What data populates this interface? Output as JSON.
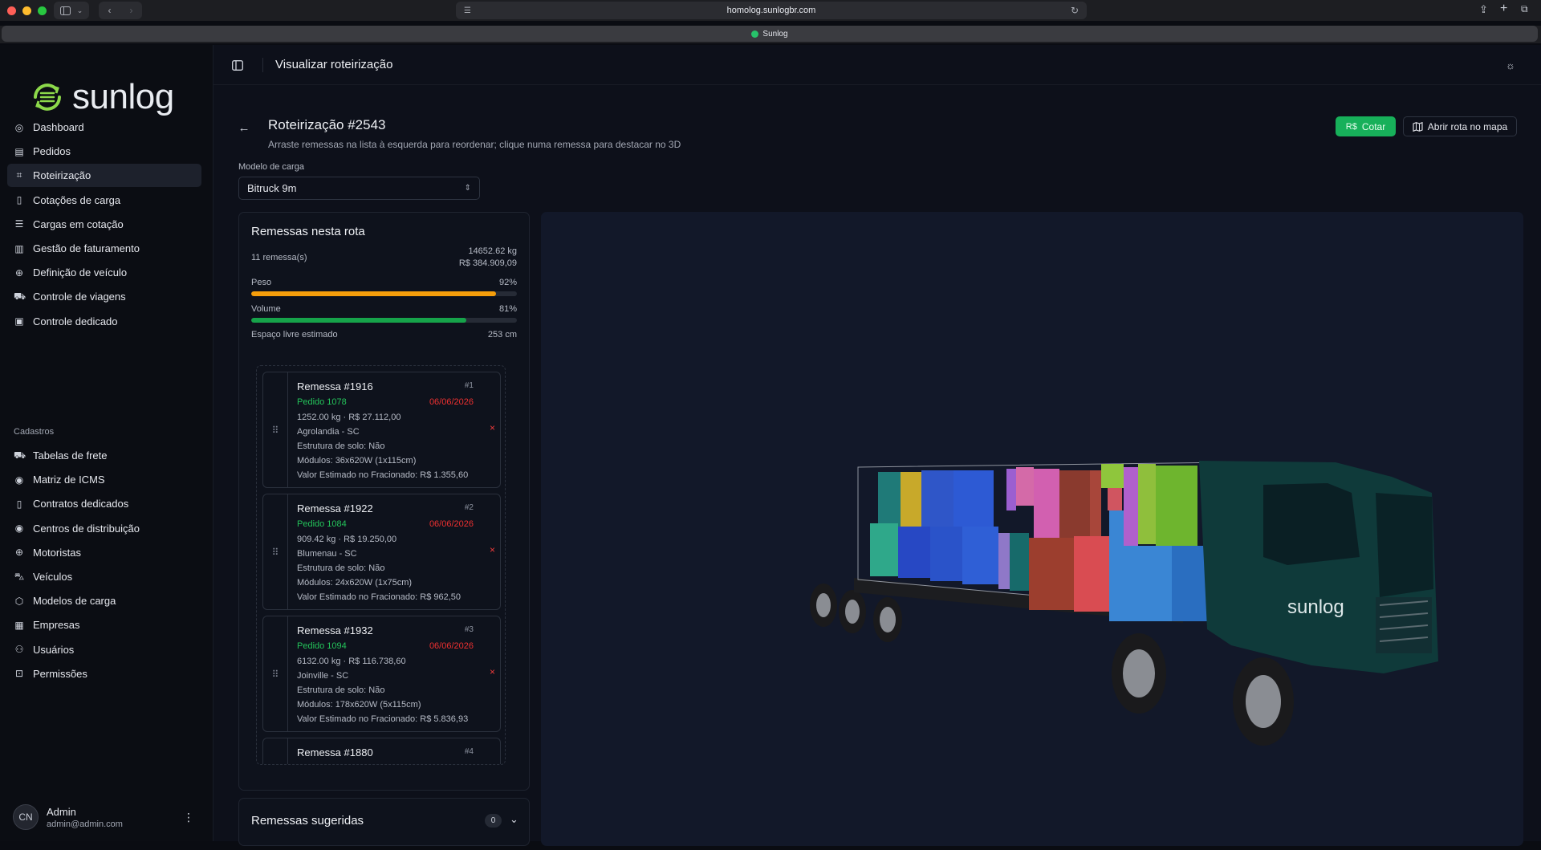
{
  "browser": {
    "url": "homolog.sunlogbr.com",
    "tab_title": "Sunlog"
  },
  "sidebar": {
    "logo": "sunlog",
    "nav": [
      {
        "label": "Dashboard",
        "icon": "dashboard-icon",
        "active": false
      },
      {
        "label": "Pedidos",
        "icon": "clipboard-icon",
        "active": false
      },
      {
        "label": "Roteirização",
        "icon": "map-icon",
        "active": true
      },
      {
        "label": "Cotações de carga",
        "icon": "file-icon",
        "active": false
      },
      {
        "label": "Cargas em cotação",
        "icon": "list-icon",
        "active": false
      },
      {
        "label": "Gestão de faturamento",
        "icon": "receipt-icon",
        "active": false
      },
      {
        "label": "Definição de veículo",
        "icon": "steering-icon",
        "active": false
      },
      {
        "label": "Controle de viagens",
        "icon": "truck-icon",
        "active": false
      },
      {
        "label": "Controle dedicado",
        "icon": "clipboard-check-icon",
        "active": false
      }
    ],
    "section_label": "Cadastros",
    "cadastros": [
      {
        "label": "Tabelas de frete",
        "icon": "truck-icon"
      },
      {
        "label": "Matriz de ICMS",
        "icon": "pin-icon"
      },
      {
        "label": "Contratos dedicados",
        "icon": "file-icon"
      },
      {
        "label": "Centros de distribuição",
        "icon": "pin-icon"
      },
      {
        "label": "Motoristas",
        "icon": "steering-icon"
      },
      {
        "label": "Veículos",
        "icon": "car-icon"
      },
      {
        "label": "Modelos de carga",
        "icon": "box-icon"
      },
      {
        "label": "Empresas",
        "icon": "building-icon"
      },
      {
        "label": "Usuários",
        "icon": "users-icon"
      },
      {
        "label": "Permissões",
        "icon": "lock-icon"
      }
    ],
    "user": {
      "initials": "CN",
      "name": "Admin",
      "email": "admin@admin.com"
    }
  },
  "header": {
    "title": "Visualizar roteirização"
  },
  "page": {
    "title": "Roteirização #2543",
    "subtitle": "Arraste remessas na lista à esquerda para reordenar; clique numa remessa para destacar no 3D",
    "quote_button": "Cotar",
    "quote_prefix": "R$",
    "map_button": "Abrir rota no mapa",
    "model_label": "Modelo de carga",
    "model_value": "Bitruck 9m"
  },
  "route_panel": {
    "title": "Remessas nesta rota",
    "count": "11 remessa(s)",
    "weight_total": "14652.62 kg",
    "value_total": "R$ 384.909,09",
    "weight_label": "Peso",
    "weight_pct_text": "92%",
    "weight_fraction": 0.92,
    "volume_label": "Volume",
    "volume_pct_text": "81%",
    "volume_fraction": 0.81,
    "free_label": "Espaço livre estimado",
    "free_value": "253 cm",
    "weight_color": "#f59e0b",
    "volume_color": "#16a34a"
  },
  "shipments": [
    {
      "title": "Remessa #1916",
      "num": "#1",
      "pedido": "Pedido 1078",
      "date": "06/06/2026",
      "line1": "1252.00 kg · R$ 27.112,00",
      "line2": "Agrolandia - SC",
      "line3": "Estrutura de solo: Não",
      "line4": "Módulos: 36x620W (1x115cm)",
      "line5": "Valor Estimado no Fracionado: R$ 1.355,60"
    },
    {
      "title": "Remessa #1922",
      "num": "#2",
      "pedido": "Pedido 1084",
      "date": "06/06/2026",
      "line1": "909.42 kg · R$ 19.250,00",
      "line2": "Blumenau - SC",
      "line3": "Estrutura de solo: Não",
      "line4": "Módulos: 24x620W (1x75cm)",
      "line5": "Valor Estimado no Fracionado: R$ 962,50"
    },
    {
      "title": "Remessa #1932",
      "num": "#3",
      "pedido": "Pedido 1094",
      "date": "06/06/2026",
      "line1": "6132.00 kg · R$ 116.738,60",
      "line2": "Joinville - SC",
      "line3": "Estrutura de solo: Não",
      "line4": "Módulos: 178x620W (5x115cm)",
      "line5": "Valor Estimado no Fracionado: R$ 5.836,93"
    },
    {
      "title": "Remessa #1880",
      "num": "#4",
      "pedido": "",
      "date": "",
      "line1": "",
      "line2": "",
      "line3": "",
      "line4": "",
      "line5": ""
    }
  ],
  "suggested": {
    "title": "Remessas sugeridas",
    "count": "0"
  },
  "truck": {
    "brand": "sunlog"
  }
}
